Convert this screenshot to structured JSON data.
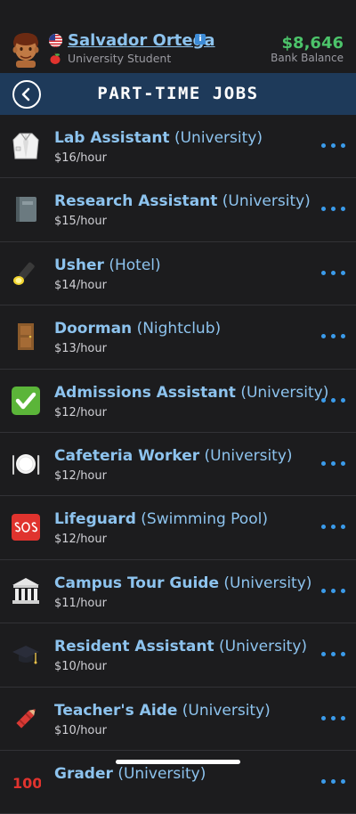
{
  "header": {
    "name": "Salvador Ortega",
    "subtitle": "University Student",
    "balance": "$8,646",
    "balance_label": "Bank Balance",
    "info_badge": "i"
  },
  "nav": {
    "title": "PART-TIME JOBS"
  },
  "jobs": [
    {
      "title": "Lab Assistant",
      "employer": "(University)",
      "pay": "$16/hour",
      "icon": "lab-coat-icon"
    },
    {
      "title": "Research Assistant",
      "employer": "(University)",
      "pay": "$15/hour",
      "icon": "notebook-icon"
    },
    {
      "title": "Usher",
      "employer": "(Hotel)",
      "pay": "$14/hour",
      "icon": "flashlight-icon"
    },
    {
      "title": "Doorman",
      "employer": "(Nightclub)",
      "pay": "$13/hour",
      "icon": "door-icon"
    },
    {
      "title": "Admissions Assistant",
      "employer": "(University)",
      "pay": "$12/hour",
      "icon": "checkmark-icon"
    },
    {
      "title": "Cafeteria Worker",
      "employer": "(University)",
      "pay": "$12/hour",
      "icon": "plate-cutlery-icon"
    },
    {
      "title": "Lifeguard",
      "employer": "(Swimming Pool)",
      "pay": "$12/hour",
      "icon": "sos-icon"
    },
    {
      "title": "Campus Tour Guide",
      "employer": "(University)",
      "pay": "$11/hour",
      "icon": "classical-building-icon"
    },
    {
      "title": "Resident Assistant",
      "employer": "(University)",
      "pay": "$10/hour",
      "icon": "graduation-cap-icon"
    },
    {
      "title": "Teacher's Aide",
      "employer": "(University)",
      "pay": "$10/hour",
      "icon": "crayon-icon"
    },
    {
      "title": "Grader",
      "employer": "(University)",
      "pay": "",
      "icon": "hundred-points-icon"
    }
  ],
  "colors": {
    "link_blue": "#8dc3ee",
    "balance_green": "#4cc36a",
    "nav_bg": "#1e3a5a",
    "dots_blue": "#3b9bea"
  }
}
